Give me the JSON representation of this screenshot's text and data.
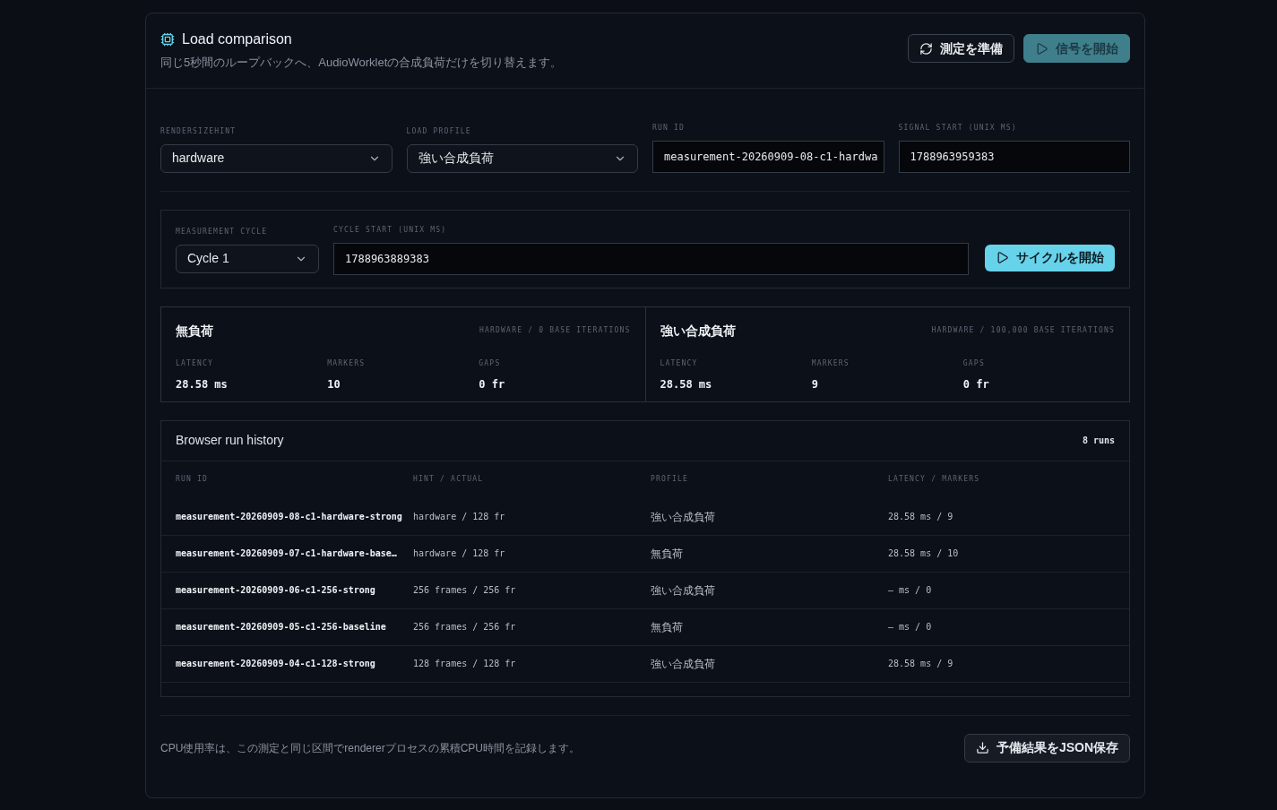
{
  "header": {
    "title": "Load comparison",
    "subtitle": "同じ5秒間のループバックへ、AudioWorkletの合成負荷だけを切り替えます。",
    "buttons": [
      {
        "kind": "refresh",
        "label": "測定を準備",
        "disabled": false
      },
      {
        "kind": "play",
        "label": "信号を開始",
        "disabled": true
      }
    ]
  },
  "fields": [
    {
      "kind": "select",
      "label": "RENDERSIZEHINT",
      "value": "hardware"
    },
    {
      "kind": "select",
      "label": "LOAD PROFILE",
      "value": "強い合成負荷"
    },
    {
      "kind": "input",
      "label": "RUN ID",
      "value": "measurement-20260909-08-c1-hardwa"
    },
    {
      "kind": "input",
      "label": "SIGNAL START (UNIX MS)",
      "value": "1788963959383"
    }
  ],
  "cycle": {
    "select_label": "MEASUREMENT CYCLE",
    "select_value": "Cycle 1",
    "start_label": "CYCLE START (UNIX MS)",
    "start_value": "1788963889383",
    "button": "サイクルを開始"
  },
  "profiles": [
    {
      "name": "無負荷",
      "meta": "HARDWARE / 0 BASE ITERATIONS",
      "stats": [
        {
          "label": "LATENCY",
          "value": "28.58 ms"
        },
        {
          "label": "MARKERS",
          "value": "10"
        },
        {
          "label": "GAPS",
          "value": "0 fr"
        }
      ]
    },
    {
      "name": "強い合成負荷",
      "meta": "HARDWARE / 100,000 BASE ITERATIONS",
      "stats": [
        {
          "label": "LATENCY",
          "value": "28.58 ms"
        },
        {
          "label": "MARKERS",
          "value": "9"
        },
        {
          "label": "GAPS",
          "value": "0 fr"
        }
      ]
    }
  ],
  "history": {
    "title": "Browser run history",
    "count": "8 runs",
    "columns": [
      "RUN ID",
      "HINT / ACTUAL",
      "PROFILE",
      "LATENCY / MARKERS"
    ],
    "rows": [
      [
        "measurement-20260909-08-c1-hardware-strong",
        "hardware / 128 fr",
        "強い合成負荷",
        "28.58 ms / 9"
      ],
      [
        "measurement-20260909-07-c1-hardware-base…",
        "hardware / 128 fr",
        "無負荷",
        "28.58 ms / 10"
      ],
      [
        "measurement-20260909-06-c1-256-strong",
        "256 frames / 256 fr",
        "強い合成負荷",
        "— ms / 0"
      ],
      [
        "measurement-20260909-05-c1-256-baseline",
        "256 frames / 256 fr",
        "無負荷",
        "— ms / 0"
      ],
      [
        "measurement-20260909-04-c1-128-strong",
        "128 frames / 128 fr",
        "強い合成負荷",
        "28.58 ms / 9"
      ]
    ]
  },
  "footer": {
    "note": "CPU使用率は、この測定と同じ区間でrendererプロセスの累積CPU時間を記録します。",
    "button": "予備結果をJSON保存"
  }
}
